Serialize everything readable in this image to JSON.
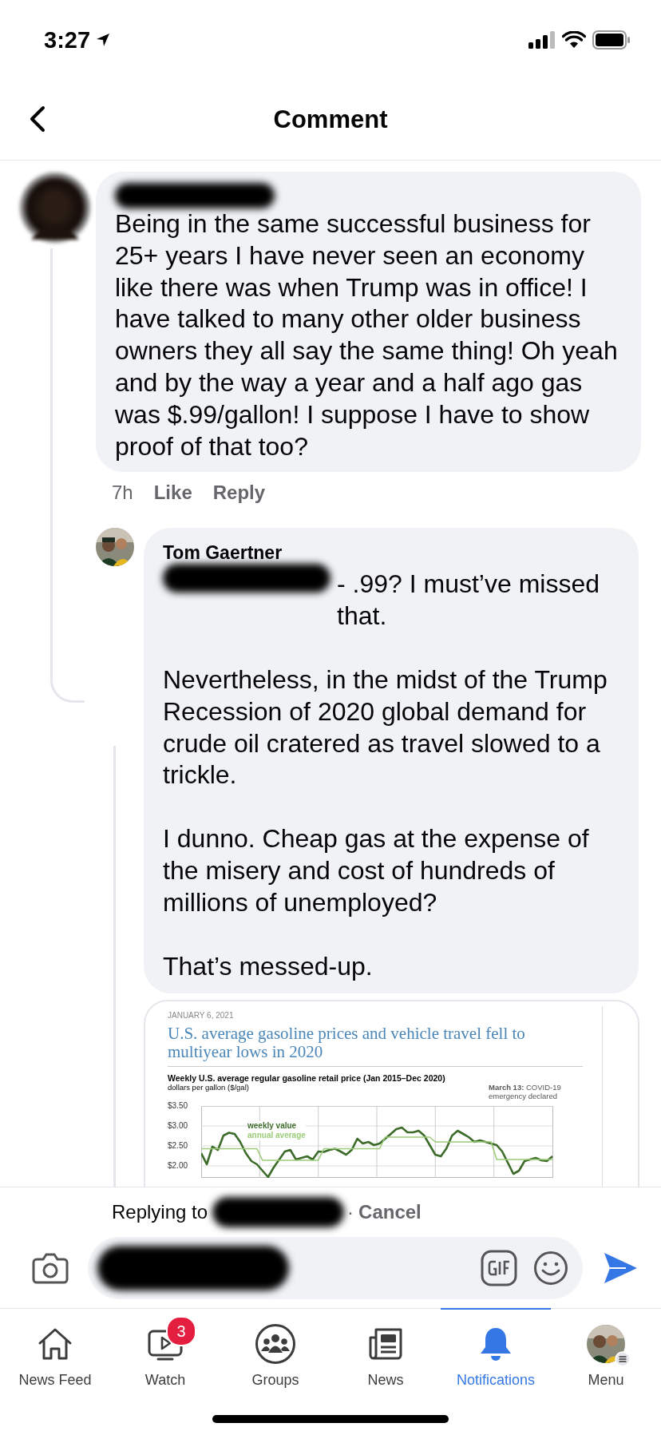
{
  "status_bar": {
    "time": "3:27"
  },
  "header": {
    "title": "Comment"
  },
  "comment": {
    "name_redacted": true,
    "text": "Being in the same successful business for 25+ years I have never seen an economy like there was when Trump was in office! I have talked to many other older business owners they all say the same thing! Oh yeah and by the way a year and a half ago gas was $.99/gallon! I suppose I have to show proof of that too?",
    "time": "7h",
    "actions": [
      "Like",
      "Reply"
    ]
  },
  "reply": {
    "author": "Tom Gaertner",
    "mention_redacted": true,
    "paragraphs": [
      "- .99?  I must’ve missed that.",
      "Nevertheless, in the midst of the Trump Recession of 2020 global demand for crude oil cratered as travel slowed to a trickle.",
      "I dunno. Cheap gas at the expense of the misery and cost of hundreds of millions of unemployed?",
      "That’s messed-up."
    ],
    "attachment": {
      "date": "JANUARY 6, 2021",
      "title": "U.S. average gasoline prices and vehicle travel fell to multiyear lows in 2020",
      "chart_title": "Weekly U.S. average regular gasoline retail price (Jan 2015–Dec 2020)",
      "unit": "dollars per gallon ($/gal)",
      "annotation": "**March 13:** COVID-19 emergency declared",
      "chart_data": {
        "type": "line",
        "grid": true,
        "ylim": [
          1.7,
          3.5
        ],
        "yticks": [
          {
            "value": 3.5,
            "label": "$3.50"
          },
          {
            "value": 3,
            "label": "$3.00"
          },
          {
            "value": 2.5,
            "label": "$2.50"
          },
          {
            "value": 2,
            "label": "$2.00"
          }
        ],
        "categories": [
          null,
          null,
          null,
          null,
          null,
          null,
          null,
          null,
          null,
          null,
          null,
          null,
          null,
          null,
          null,
          null,
          null,
          null,
          null,
          null,
          null,
          null,
          null,
          null,
          null,
          null,
          null,
          null,
          null,
          null,
          null,
          null,
          null,
          null,
          null,
          null,
          null,
          null,
          null,
          null,
          null,
          null,
          null,
          null,
          null,
          null,
          null,
          null,
          null,
          null,
          null,
          null,
          null,
          null,
          null,
          null,
          null,
          null,
          null,
          null,
          null,
          null,
          null,
          null
        ],
        "series": [
          {
            "name": "weekly value",
            "color": "#3d6b2a",
            "values": [
              2.32,
              2.04,
              2.48,
              2.4,
              2.76,
              2.83,
              2.8,
              2.6,
              2.32,
              2.12,
              2.04,
              1.88,
              1.72,
              1.96,
              2.16,
              2.36,
              2.4,
              2.16,
              2.2,
              2.24,
              2.16,
              2.36,
              2.35,
              2.4,
              2.43,
              2.36,
              2.28,
              2.4,
              2.68,
              2.56,
              2.6,
              2.52,
              2.56,
              2.68,
              2.8,
              2.92,
              2.96,
              2.84,
              2.84,
              2.88,
              2.76,
              2.52,
              2.28,
              2.24,
              2.44,
              2.76,
              2.88,
              2.8,
              2.72,
              2.6,
              2.64,
              2.6,
              2.56,
              2.52,
              2.36,
              2.08,
              1.8,
              1.88,
              2.12,
              2.16,
              2.2,
              2.14,
              2.12,
              2.24
            ]
          },
          {
            "name": "annual average",
            "color": "#9ccc7a",
            "values": [
              2.43,
              2.43,
              2.43,
              2.43,
              2.43,
              2.43,
              2.43,
              2.43,
              2.43,
              2.43,
              2.43,
              2.14,
              2.14,
              2.14,
              2.14,
              2.14,
              2.14,
              2.14,
              2.14,
              2.14,
              2.14,
              2.14,
              2.43,
              2.43,
              2.43,
              2.43,
              2.43,
              2.43,
              2.43,
              2.43,
              2.43,
              2.43,
              2.43,
              2.72,
              2.72,
              2.72,
              2.72,
              2.72,
              2.72,
              2.72,
              2.72,
              2.72,
              2.6,
              2.6,
              2.6,
              2.6,
              2.6,
              2.6,
              2.6,
              2.6,
              2.6,
              2.6,
              2.6,
              2.16,
              2.16,
              2.16,
              2.16,
              2.16,
              2.16,
              2.16,
              2.16,
              2.16,
              2.16,
              2.16
            ]
          }
        ]
      }
    }
  },
  "composer": {
    "replying_label": "Replying to",
    "target_redacted": true,
    "separator": "·",
    "cancel": "Cancel",
    "text_redacted": true
  },
  "tabs": [
    {
      "label": "News Feed",
      "kind": "home",
      "selected": false
    },
    {
      "label": "Watch",
      "kind": "watch",
      "selected": false,
      "badge": "3"
    },
    {
      "label": "Groups",
      "kind": "groups",
      "selected": false
    },
    {
      "label": "News",
      "kind": "news",
      "selected": false
    },
    {
      "label": "Notifications",
      "kind": "bell",
      "selected": true
    },
    {
      "label": "Menu",
      "kind": "avatar",
      "selected": false
    }
  ]
}
